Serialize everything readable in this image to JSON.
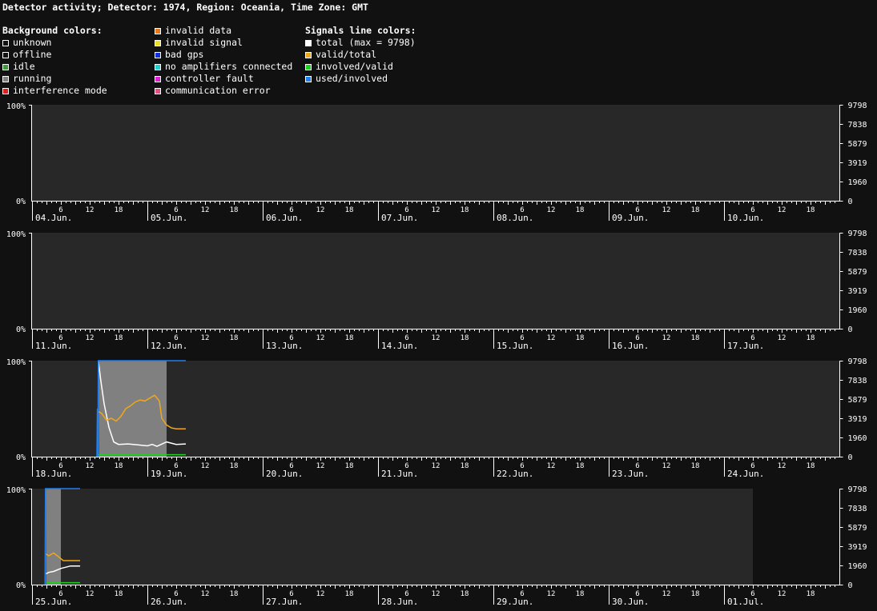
{
  "title": "Detector activity; Detector: 1974, Region: Oceania, Time Zone: GMT",
  "legend": {
    "background_heading": "Background colors:",
    "background": [
      {
        "label": "unknown",
        "color": "#111111"
      },
      {
        "label": "offline",
        "color": "#111111"
      },
      {
        "label": "idle",
        "color": "#3a9a3a"
      },
      {
        "label": "running",
        "color": "#808080"
      },
      {
        "label": "interference mode",
        "color": "#e02020"
      },
      {
        "label": "invalid data",
        "color": "#e07a20"
      },
      {
        "label": "invalid signal",
        "color": "#e8e020"
      },
      {
        "label": "bad gps",
        "color": "#1030e0"
      },
      {
        "label": "no amplifiers connected",
        "color": "#20d0d0"
      },
      {
        "label": "controller fault",
        "color": "#e020d0"
      },
      {
        "label": "communication error",
        "color": "#e05080"
      }
    ],
    "signals_heading": "Signals line colors:",
    "signals": [
      {
        "label": "total (max = 9798)",
        "color": "#ffffff"
      },
      {
        "label": "valid/total",
        "color": "#f0a818"
      },
      {
        "label": "involved/valid",
        "color": "#20d020"
      },
      {
        "label": "used/involved",
        "color": "#2080f0"
      }
    ]
  },
  "chart_data": {
    "type": "line",
    "x_unit": "hours since 04.Jun. 00:00 GMT",
    "left_axis_labels": [
      "100%",
      "0%"
    ],
    "right_axis_labels": [
      "9798",
      "7838",
      "5879",
      "3919",
      "1960",
      "0"
    ],
    "hour_tick_labels": [
      "6",
      "12",
      "18"
    ],
    "colors": {
      "panel_bg": "#282828",
      "outside_bg": "#111111",
      "running": "#808080",
      "total": "#ffffff",
      "valid_total": "#f0a818",
      "involved_valid": "#20d020",
      "used_involved": "#2080f0"
    },
    "rows": [
      {
        "days": [
          "04.Jun.",
          "05.Jun.",
          "06.Jun.",
          "07.Jun.",
          "08.Jun.",
          "09.Jun.",
          "10.Jun."
        ],
        "data_end": 168
      },
      {
        "days": [
          "11.Jun.",
          "12.Jun.",
          "13.Jun.",
          "14.Jun.",
          "15.Jun.",
          "16.Jun.",
          "17.Jun."
        ],
        "data_end": 168
      },
      {
        "days": [
          "18.Jun.",
          "19.Jun.",
          "20.Jun.",
          "21.Jun.",
          "22.Jun.",
          "23.Jun.",
          "24.Jun."
        ],
        "data_end": 168
      },
      {
        "days": [
          "25.Jun.",
          "26.Jun.",
          "27.Jun.",
          "28.Jun.",
          "29.Jun.",
          "30.Jun.",
          "01.Jul."
        ],
        "data_end": 150
      }
    ],
    "running_periods": [
      {
        "start": 349.9,
        "end": 364.0
      },
      {
        "start": 506.9,
        "end": 510.0
      }
    ],
    "series": [
      {
        "name": "total",
        "unit": "signals",
        "segments": [
          [
            [
              349.8,
              9798
            ],
            [
              350.3,
              7800
            ],
            [
              351.0,
              5400
            ],
            [
              352.0,
              3000
            ],
            [
              353.0,
              1500
            ],
            [
              354.0,
              1250
            ],
            [
              356.0,
              1300
            ],
            [
              358.0,
              1200
            ],
            [
              360.0,
              1100
            ],
            [
              361.0,
              1250
            ],
            [
              362.0,
              1050
            ],
            [
              364.0,
              1500
            ],
            [
              366.0,
              1250
            ],
            [
              368.0,
              1300
            ]
          ],
          [
            [
              506.9,
              1100
            ],
            [
              507.5,
              1250
            ],
            [
              508.5,
              1350
            ],
            [
              510.0,
              1650
            ],
            [
              512.0,
              1900
            ],
            [
              514.0,
              1900
            ]
          ]
        ]
      },
      {
        "name": "valid/total",
        "unit": "percent",
        "segments": [
          [
            [
              349.8,
              47
            ],
            [
              350.5,
              45
            ],
            [
              351.5,
              38
            ],
            [
              352.5,
              40
            ],
            [
              353.5,
              37
            ],
            [
              354.5,
              42
            ],
            [
              355.5,
              50
            ],
            [
              356.5,
              53
            ],
            [
              357.5,
              57
            ],
            [
              358.5,
              59
            ],
            [
              359.5,
              58
            ],
            [
              360.5,
              61
            ],
            [
              361.5,
              64
            ],
            [
              362.5,
              58
            ],
            [
              363.0,
              40
            ],
            [
              364.0,
              33
            ],
            [
              365.0,
              30
            ],
            [
              366.0,
              29
            ],
            [
              368.0,
              29
            ]
          ],
          [
            [
              506.9,
              32
            ],
            [
              507.5,
              30
            ],
            [
              508.5,
              33
            ],
            [
              509.5,
              29
            ],
            [
              510.5,
              25
            ],
            [
              514.0,
              25
            ]
          ]
        ]
      },
      {
        "name": "involved/valid",
        "unit": "percent",
        "segments": [
          [
            [
              349.8,
              2
            ],
            [
              368.0,
              2
            ]
          ],
          [
            [
              506.9,
              2
            ],
            [
              514.0,
              2
            ]
          ]
        ]
      },
      {
        "name": "used/involved",
        "unit": "percent",
        "segments": [
          [
            [
              349.5,
              0
            ],
            [
              349.6,
              50
            ],
            [
              349.7,
              0
            ],
            [
              349.8,
              100
            ],
            [
              368.0,
              100
            ]
          ],
          [
            [
              506.7,
              0
            ],
            [
              506.8,
              100
            ],
            [
              514.0,
              100
            ]
          ]
        ]
      }
    ]
  }
}
